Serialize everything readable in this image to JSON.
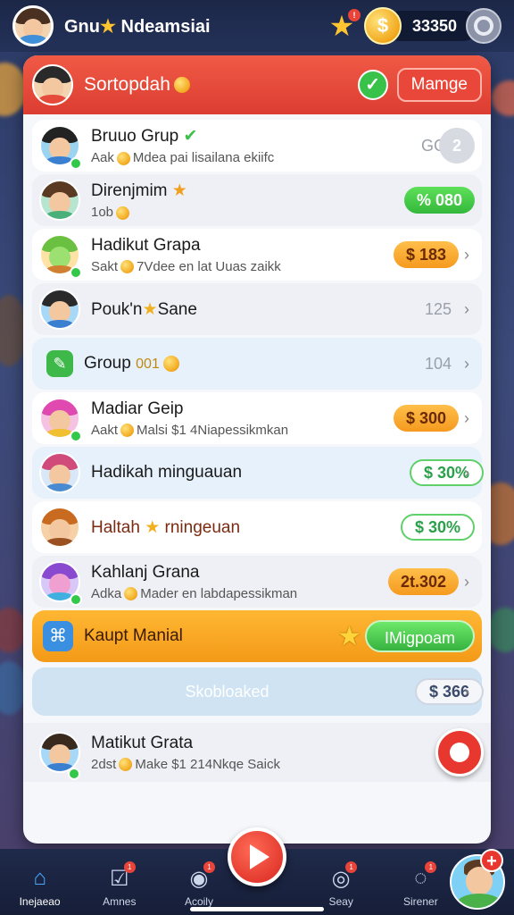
{
  "topbar": {
    "player_name_a": "Gnu",
    "player_name_b": "Ndeamsiai",
    "star_icon": "star-icon",
    "coin_symbol": "$",
    "coins": "33350"
  },
  "panel": {
    "title": "Sortopdah",
    "action_label": "Mamge"
  },
  "rows": [
    {
      "name": "Bruuo Grup",
      "sub_a": "Aak",
      "sub_b": "Mdea pai lisailana ekiifc",
      "value": "2",
      "value_prefix": "GG"
    },
    {
      "name": "Direnjmim",
      "sub_a": "1ob",
      "value": "% 080"
    },
    {
      "name": "Hadikut Grapa",
      "sub_a": "Sakt",
      "sub_b": "7Vdee en lat Uuas zaikk",
      "value": "$ 183"
    },
    {
      "name": "Pouk'n",
      "name_b": "Sane",
      "value": "125"
    },
    {
      "name": "Group",
      "name_b": "001",
      "value": "104"
    },
    {
      "name": "Madiar Geip",
      "sub_a": "Aakt",
      "sub_b": "Malsi $1 4Niapessikmkan",
      "value": "$ 300"
    },
    {
      "name": "Hadikah minguauan",
      "value": "$ 30%"
    },
    {
      "name": "Haltah",
      "name_b": "rningeuan",
      "value": "$ 30%"
    },
    {
      "name": "Kahlanj Grana",
      "sub_a": "Adka",
      "sub_b": "Mader en labdapessikman",
      "value": "2t.302"
    }
  ],
  "featured": {
    "name": "Kaupt Manial",
    "button": "IMigpoam"
  },
  "search": {
    "placeholder": "Skobloaked",
    "value": "$ 366"
  },
  "bottom_row": {
    "name": "Matikut Grata",
    "sub_a": "2dst",
    "sub_b": "Make $1 214Nkqe Saick"
  },
  "nav": [
    {
      "label": "Inejaeao",
      "icon": "home-icon"
    },
    {
      "label": "Amnes",
      "icon": "inbox-icon",
      "badge": "1"
    },
    {
      "label": "Acoily",
      "icon": "chat-icon",
      "badge": "1"
    },
    {
      "label": "Seay",
      "icon": "search-icon",
      "badge": "1"
    },
    {
      "label": "Sirener",
      "icon": "bell-icon",
      "badge": "1"
    }
  ],
  "colors": {
    "header": "#dc3d32",
    "accent_green": "#36b33f",
    "accent_orange": "#f39a18"
  }
}
